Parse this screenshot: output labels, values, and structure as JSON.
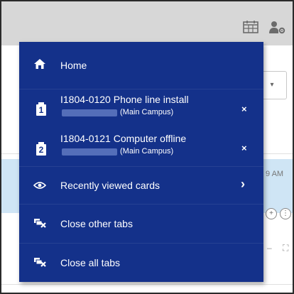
{
  "menu": {
    "home_label": "Home",
    "tabs": [
      {
        "number": "1",
        "title": "I1804-0120 Phone line install",
        "campus": "(Main Campus)",
        "close": "×"
      },
      {
        "number": "2",
        "title": "I1804-0121 Computer offline",
        "campus": "(Main Campus)",
        "close": "×"
      }
    ],
    "recently_viewed_label": "Recently viewed cards",
    "close_other_label": "Close other tabs",
    "close_all_label": "Close all tabs"
  },
  "background": {
    "time_fragment": "9 AM",
    "select_caret": "▾"
  },
  "colors": {
    "menu_bg": "#14318a",
    "topbar_bg": "#d7d7d7",
    "highlight_strip": "#cfe5f5"
  },
  "icons": {
    "topbar": [
      "calendar-grid-icon",
      "user-settings-icon"
    ],
    "menu": [
      "home-icon",
      "card-number-icon",
      "eye-icon",
      "close-tabs-icon",
      "chevron-right-icon",
      "close-icon"
    ]
  }
}
